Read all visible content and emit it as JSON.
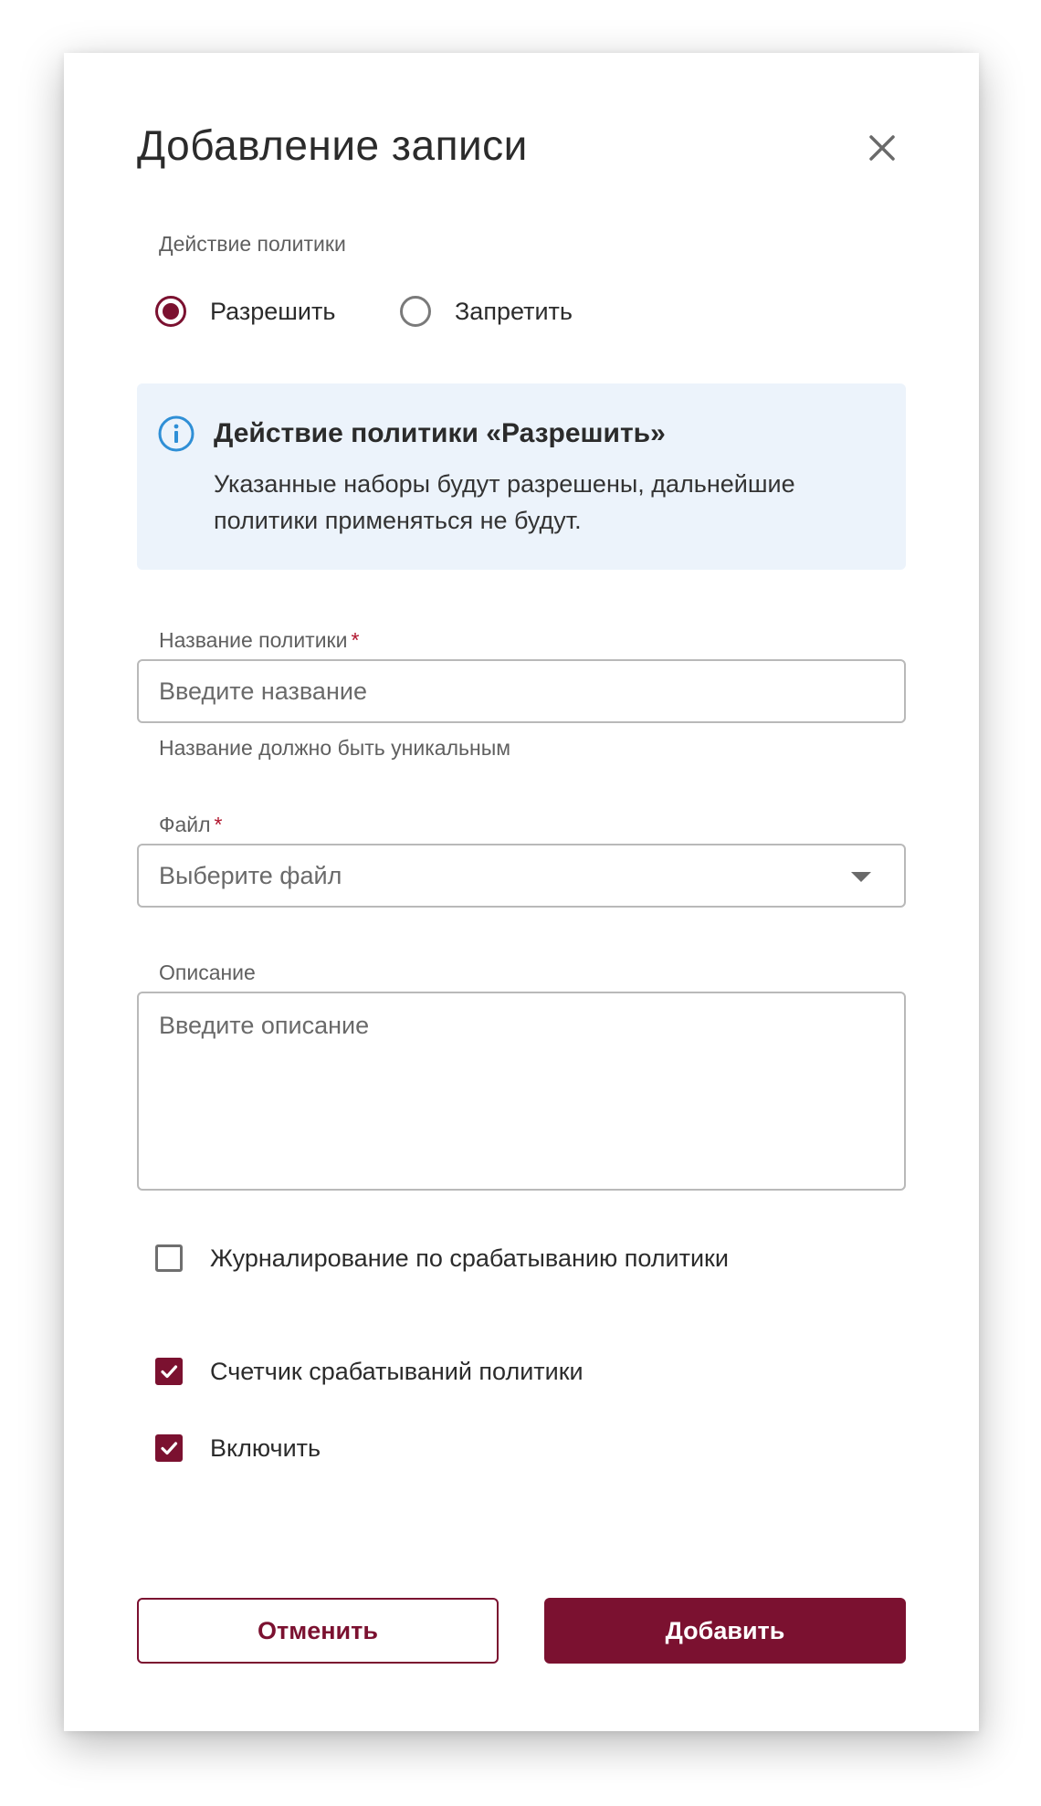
{
  "dialog": {
    "title": "Добавление записи",
    "close_icon": "close-icon"
  },
  "policy_action": {
    "label": "Действие политики",
    "options": [
      {
        "label": "Разрешить",
        "checked": true
      },
      {
        "label": "Запретить",
        "checked": false
      }
    ]
  },
  "info": {
    "icon": "info-icon",
    "title": "Действие политики «Разрешить»",
    "text": "Указанные наборы будут разрешены, дальнейшие политики применяться не будут."
  },
  "name_field": {
    "label": "Название политики",
    "required_mark": "*",
    "placeholder": "Введите название",
    "helper": "Название должно быть уникальным"
  },
  "file_field": {
    "label": "Файл",
    "required_mark": "*",
    "placeholder": "Выберите файл"
  },
  "description_field": {
    "label": "Описание",
    "placeholder": "Введите описание"
  },
  "checkboxes": [
    {
      "label": "Журналирование по срабатыванию политики",
      "checked": false
    },
    {
      "label": "Счетчик срабатываний политики",
      "checked": true
    },
    {
      "label": "Включить",
      "checked": true
    }
  ],
  "buttons": {
    "cancel": "Отменить",
    "add": "Добавить"
  },
  "colors": {
    "accent": "#7b1130",
    "info_bg": "#ecf3fb",
    "info_icon": "#2f8fd6",
    "required": "#b0142c"
  }
}
